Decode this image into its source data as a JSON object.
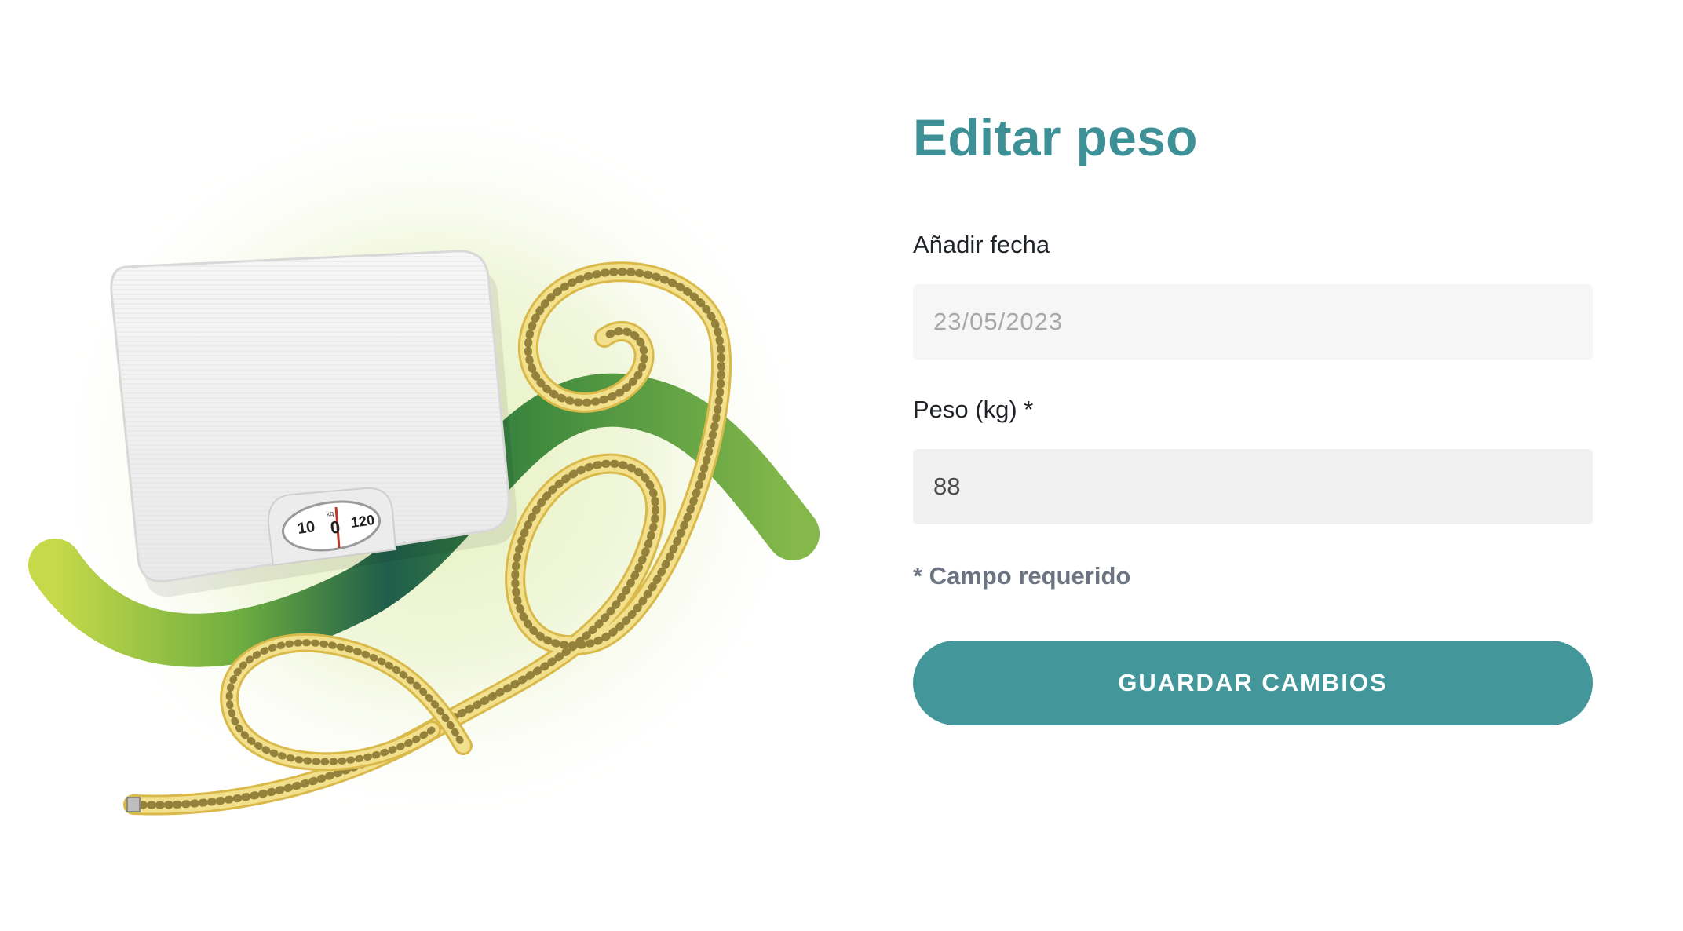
{
  "form": {
    "title": "Editar peso",
    "date_label": "Añadir fecha",
    "date_value": "23/05/2023",
    "weight_label": "Peso (kg) *",
    "weight_value": "88",
    "required_note": "* Campo requerido",
    "save_label": "GUARDAR CAMBIOS"
  },
  "illustration": {
    "scale_dial": {
      "left_number": "10",
      "center_number": "0",
      "right_number": "120",
      "unit": "kg"
    },
    "icons": [
      "bathroom-scale-icon",
      "measuring-tape-icon",
      "green-ribbon-swoosh"
    ]
  },
  "colors": {
    "accent": "#43979a",
    "title": "#3d9196",
    "ribbon_green": "#7cb342",
    "tape_yellow": "#e8d27a",
    "glow": "#eef6d4"
  }
}
